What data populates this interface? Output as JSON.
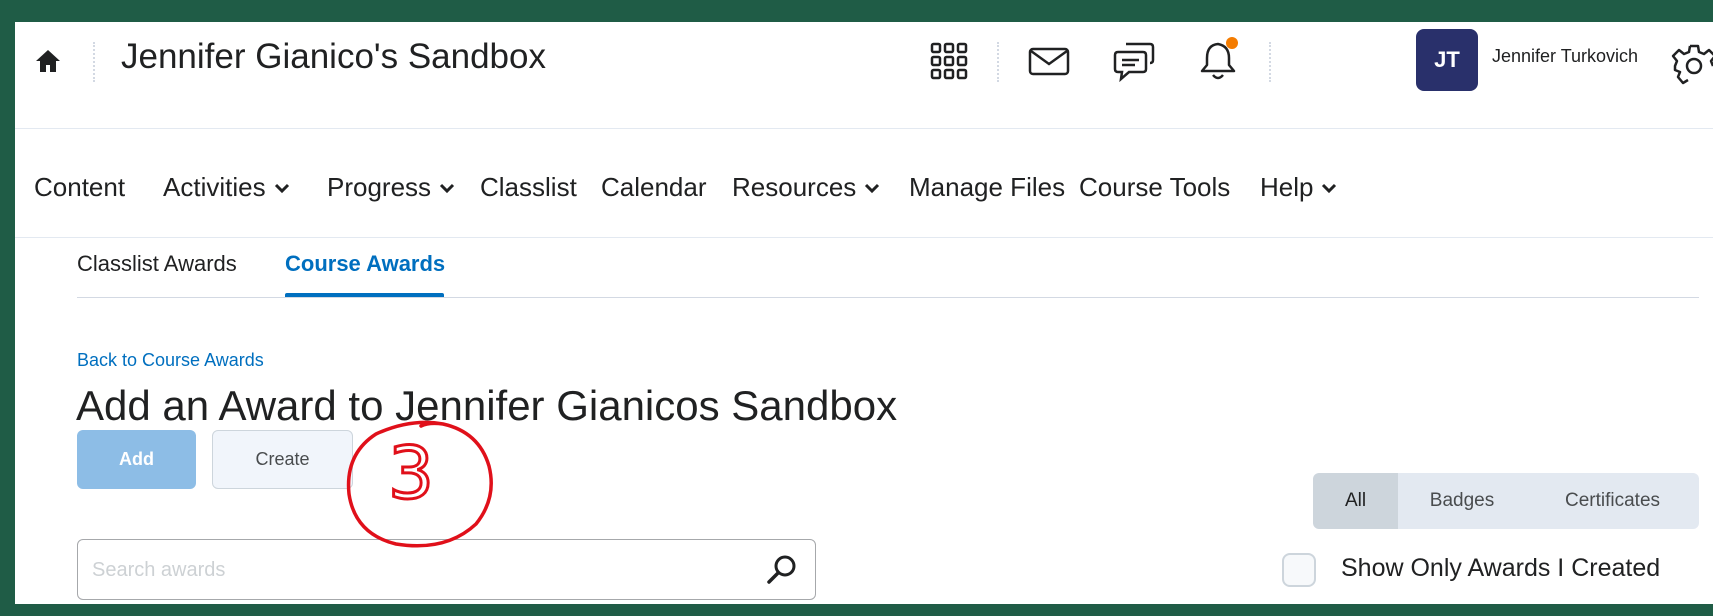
{
  "header": {
    "org_title": "Jennifer Gianico's Sandbox",
    "user_initials": "JT",
    "user_name": "Jennifer Turkovich",
    "notification_dot_color": "#f47c00",
    "avatar_color": "#29306b",
    "icons": [
      "home-icon",
      "apps-grid-icon",
      "email-icon",
      "chat-icon",
      "bell-icon",
      "gear-icon"
    ]
  },
  "nav": {
    "items": [
      {
        "label": "Content",
        "dropdown": false
      },
      {
        "label": "Activities",
        "dropdown": true
      },
      {
        "label": "Progress",
        "dropdown": true
      },
      {
        "label": "Classlist",
        "dropdown": false
      },
      {
        "label": "Calendar",
        "dropdown": false
      },
      {
        "label": "Resources",
        "dropdown": true
      },
      {
        "label": "Manage Files",
        "dropdown": false
      },
      {
        "label": "Course Tools",
        "dropdown": false
      },
      {
        "label": "Help",
        "dropdown": true
      }
    ]
  },
  "tabs": [
    {
      "label": "Classlist Awards",
      "active": false
    },
    {
      "label": "Course Awards",
      "active": true
    }
  ],
  "main": {
    "back_link": "Back to Course Awards",
    "heading": "Add an Award to Jennifer Gianicos Sandbox",
    "add_button": "Add",
    "create_button": "Create",
    "filters": [
      "All",
      "Badges",
      "Certificates"
    ],
    "selected_filter": "All",
    "search_placeholder": "Search awards",
    "checkbox_label": "Show Only Awards I Created",
    "checkbox_checked": false
  },
  "annotation": {
    "text": "3",
    "color": "#e0101a"
  },
  "colors": {
    "frame": "#1f5c46",
    "link": "#006fbf",
    "add_button": "#8dbde6"
  }
}
